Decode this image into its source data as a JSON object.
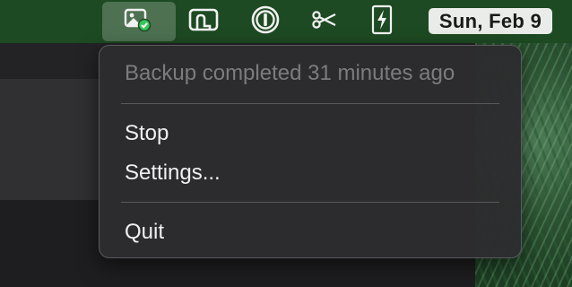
{
  "menubar": {
    "date": "Sun, Feb 9",
    "icons": [
      "photo-backup-icon",
      "printer-app-icon",
      "password-manager-icon",
      "scissors-icon",
      "bolt-icon"
    ]
  },
  "menu": {
    "status": "Backup completed 31 minutes ago",
    "stop": "Stop",
    "settings": "Settings...",
    "quit": "Quit"
  },
  "colors": {
    "menubar_bg": "#1d4a22",
    "menu_bg": "#2c2c2e",
    "menu_text": "#f0f0f0",
    "menu_text_disabled": "#7c7c80",
    "status_green": "#34c759"
  }
}
